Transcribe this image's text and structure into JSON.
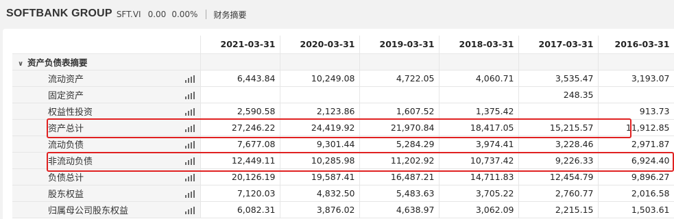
{
  "header": {
    "company": "SOFTBANK GROUP",
    "ticker": "SFT.VI",
    "price": "0.00",
    "change": "0.00%",
    "section": "财务摘要"
  },
  "table": {
    "columns": [
      "2021-03-31",
      "2020-03-31",
      "2019-03-31",
      "2018-03-31",
      "2017-03-31",
      "2016-03-31"
    ],
    "group_label": "资产负债表摘要",
    "rows": [
      {
        "label": "流动资产",
        "values": [
          "6,443.84",
          "10,249.08",
          "4,722.05",
          "4,060.71",
          "3,535.47",
          "3,193.07"
        ]
      },
      {
        "label": "固定资产",
        "values": [
          "",
          "",
          "",
          "",
          "248.35",
          ""
        ]
      },
      {
        "label": "权益性投资",
        "values": [
          "2,590.58",
          "2,123.86",
          "1,607.52",
          "1,375.42",
          "",
          "913.73"
        ]
      },
      {
        "label": "资产总计",
        "values": [
          "27,246.22",
          "24,419.92",
          "21,970.84",
          "18,417.05",
          "15,215.57",
          "11,912.85"
        ]
      },
      {
        "label": "流动负债",
        "values": [
          "7,677.08",
          "9,301.44",
          "5,284.29",
          "3,974.41",
          "3,228.46",
          "2,971.87"
        ]
      },
      {
        "label": "非流动负债",
        "values": [
          "12,449.11",
          "10,285.98",
          "11,202.92",
          "10,737.42",
          "9,226.33",
          "6,924.40"
        ]
      },
      {
        "label": "负债总计",
        "values": [
          "20,126.19",
          "19,587.41",
          "16,487.21",
          "14,711.83",
          "12,454.79",
          "9,896.27"
        ]
      },
      {
        "label": "股东权益",
        "values": [
          "7,120.03",
          "4,832.50",
          "5,483.63",
          "3,705.22",
          "2,760.77",
          "2,016.58"
        ]
      },
      {
        "label": "归属母公司股东权益",
        "values": [
          "6,082.31",
          "3,876.02",
          "4,638.97",
          "3,062.09",
          "2,215.15",
          "1,503.61"
        ]
      }
    ]
  },
  "colors": {
    "highlight": "#e02020",
    "row_bg": "#f5f5f5",
    "page_bg": "#f2f2f2"
  },
  "icons": {
    "group_toggle": "chevron-down-icon",
    "row_chart": "bar-chart-icon"
  }
}
